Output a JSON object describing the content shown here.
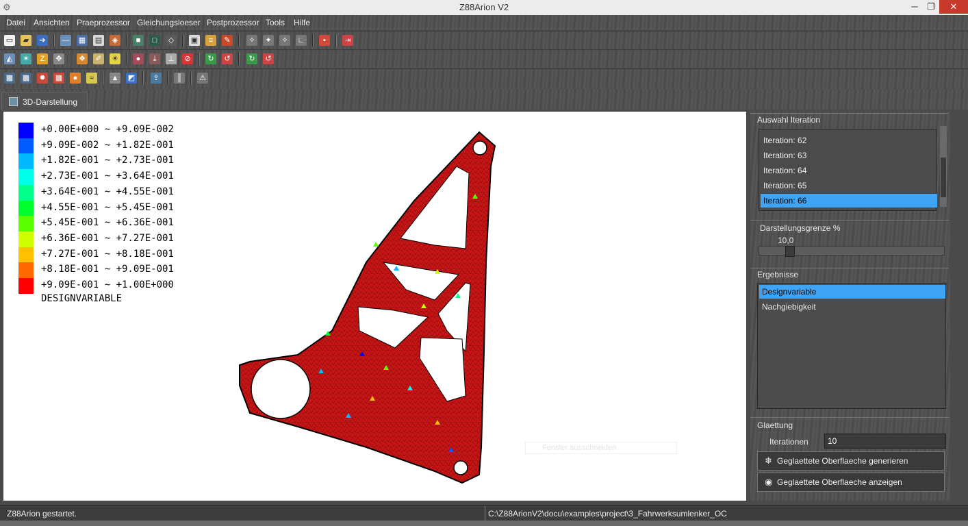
{
  "window": {
    "title": "Z88Arion V2",
    "app_icon": "gear-wrench-icon",
    "min": "─",
    "max": "❐",
    "close": "✕"
  },
  "menu": [
    "Datei",
    "Ansichten",
    "Praeprozessor",
    "Gleichungsloeser",
    "Postprozessor",
    "Tools",
    "Hilfe"
  ],
  "tab": {
    "label": "3D-Darstellung"
  },
  "legend": {
    "rows": [
      {
        "text": "+0.00E+000 ~ +9.09E-002",
        "color": "#0000ff"
      },
      {
        "text": "+9.09E-002 ~ +1.82E-001",
        "color": "#005cff"
      },
      {
        "text": "+1.82E-001 ~ +2.73E-001",
        "color": "#00b9ff"
      },
      {
        "text": "+2.73E-001 ~ +3.64E-001",
        "color": "#00ffe8"
      },
      {
        "text": "+3.64E-001 ~ +4.55E-001",
        "color": "#00ff8b"
      },
      {
        "text": "+4.55E-001 ~ +5.45E-001",
        "color": "#00ff2e"
      },
      {
        "text": "+5.45E-001 ~ +6.36E-001",
        "color": "#5cff00"
      },
      {
        "text": "+6.36E-001 ~ +7.27E-001",
        "color": "#d0ff00"
      },
      {
        "text": "+7.27E-001 ~ +8.18E-001",
        "color": "#ffc000"
      },
      {
        "text": "+8.18E-001 ~ +9.09E-001",
        "color": "#ff6a00"
      },
      {
        "text": "+9.09E-001 ~ +1.00E+000",
        "color": "#ff0000"
      }
    ],
    "title": "DESIGNVARIABLE"
  },
  "viewport": {
    "ghost_hint": "Fenster ausschneiden",
    "mesh_color": "#c81414"
  },
  "panel": {
    "iteration_group": "Auswahl Iteration",
    "iterations": [
      "Iteration: 62",
      "Iteration: 63",
      "Iteration: 64",
      "Iteration: 65",
      "Iteration: 66"
    ],
    "selected_iteration": "Iteration: 66",
    "limit_group": "Darstellungsgrenze %",
    "limit_value": "10,0",
    "limit_fraction": 0.1,
    "results_group": "Ergebnisse",
    "results": [
      "Designvariable",
      "Nachgiebigkeit"
    ],
    "selected_result": "Designvariable",
    "smoothing_group": "Glaettung",
    "iterations_label": "Iterationen",
    "iterations_value": "10",
    "btn_generate": "Geglaettete Oberflaeche generieren",
    "btn_show": "Geglaettete Oberflaeche anzeigen",
    "btn_generate_icon": "snowflake-icon",
    "btn_show_icon": "eye-icon"
  },
  "status": {
    "left": "Z88Arion gestartet.",
    "path": "C:\\Z88ArionV2\\docu\\examples\\project\\3_Fahrwerksumlenker_OC"
  },
  "colors": {
    "selection": "#3fa4f3",
    "close_button": "#c7392d"
  }
}
